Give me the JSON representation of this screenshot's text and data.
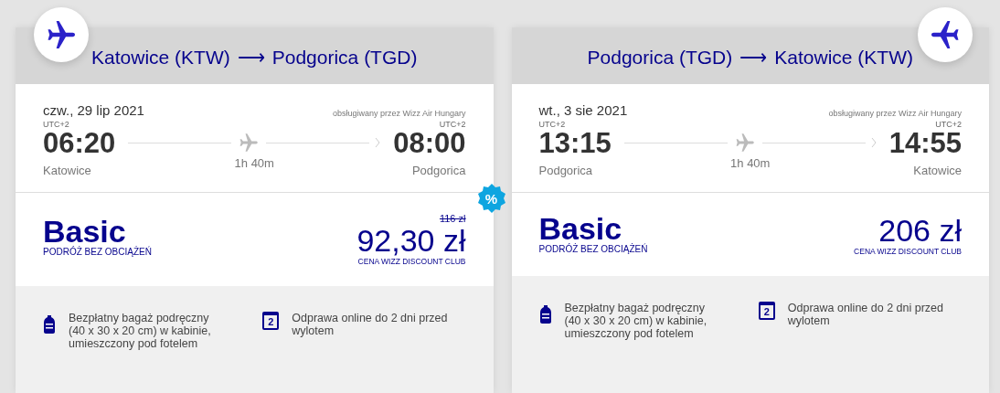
{
  "cards": [
    {
      "badge_on_right": false,
      "route": {
        "from": "Katowice (KTW)",
        "arrow": "⟶",
        "to": "Podgorica (TGD)"
      },
      "date": "czw., 29 lip 2021",
      "operator": "obsługiwany przez Wizz Air Hungary",
      "departure": {
        "tz": "UTC+2",
        "time": "06:20",
        "city": "Katowice"
      },
      "arrival": {
        "tz": "UTC+2",
        "time": "08:00",
        "city": "Podgorica"
      },
      "duration": "1h 40m",
      "fare": {
        "name": "Basic",
        "subtitle": "PODRÓŻ BEZ OBCIĄŻEŃ",
        "old_price": "116 zł",
        "price": "92,30 zł",
        "price_note": "CENA WIZZ DISCOUNT CLUB"
      },
      "discount_badge": "%",
      "features": [
        {
          "kind": "baggage",
          "text": "Bezpłatny bagaż podręczny (40 x 30 x 20 cm) w kabinie, umieszczony pod fotelem"
        },
        {
          "kind": "calendar",
          "day": "2",
          "text": "Odprawa online do 2 dni przed wylotem"
        }
      ]
    },
    {
      "badge_on_right": true,
      "route": {
        "from": "Podgorica (TGD)",
        "arrow": "⟶",
        "to": "Katowice (KTW)"
      },
      "date": "wt., 3 sie 2021",
      "operator": "obsługiwany przez Wizz Air Hungary",
      "departure": {
        "tz": "UTC+2",
        "time": "13:15",
        "city": "Podgorica"
      },
      "arrival": {
        "tz": "UTC+2",
        "time": "14:55",
        "city": "Katowice"
      },
      "duration": "1h 40m",
      "fare": {
        "name": "Basic",
        "subtitle": "PODRÓŻ BEZ OBCIĄŻEŃ",
        "price": "206 zł",
        "price_note": "CENA WIZZ DISCOUNT CLUB"
      },
      "features": [
        {
          "kind": "baggage",
          "text": "Bezpłatny bagaż podręczny (40 x 30 x 20 cm) w kabinie, umieszczony pod fotelem"
        },
        {
          "kind": "calendar",
          "day": "2",
          "text": "Odprawa online do 2 dni przed wylotem"
        }
      ]
    }
  ]
}
